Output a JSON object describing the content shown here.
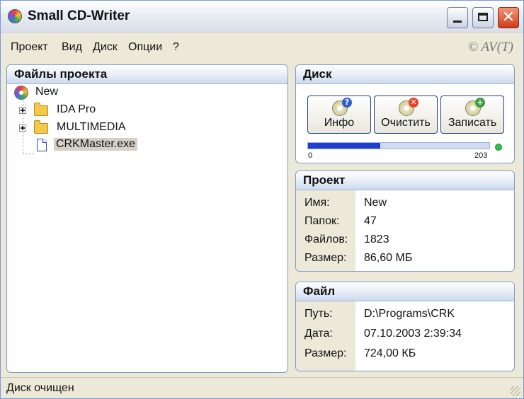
{
  "window": {
    "title": "Small CD-Writer",
    "close_glyph": "✕"
  },
  "menu": {
    "items": [
      "Проект",
      "Вид",
      "Диск",
      "Опции",
      "?"
    ],
    "copyright": "© AV(T)"
  },
  "files_panel": {
    "title": "Файлы проекта",
    "tree": [
      {
        "label": "New",
        "icon": "cd-icon"
      },
      {
        "label": "IDA Pro",
        "icon": "folder-icon",
        "expandable": true
      },
      {
        "label": "MULTIMEDIA",
        "icon": "folder-icon",
        "expandable": true
      },
      {
        "label": "CRKMaster.exe",
        "icon": "file-icon",
        "selected": true
      }
    ]
  },
  "disk_panel": {
    "title": "Диск",
    "buttons": [
      {
        "label": "Инфо",
        "icon": "disc-info-icon",
        "badge": "?"
      },
      {
        "label": "Очистить",
        "icon": "disc-erase-icon",
        "badge": "✕"
      },
      {
        "label": "Записать",
        "icon": "disc-burn-icon",
        "badge": "+"
      }
    ],
    "progress": {
      "value": 0.4,
      "min_label": "0",
      "max_label": "203"
    },
    "status_color": "#31c046"
  },
  "project_panel": {
    "title": "Проект",
    "rows": [
      {
        "key": "Имя:",
        "value": "New"
      },
      {
        "key": "Папок:",
        "value": "47"
      },
      {
        "key": "Файлов:",
        "value": "1823"
      },
      {
        "key": "Размер:",
        "value": "86,60 МБ"
      }
    ]
  },
  "file_panel": {
    "title": "Файл",
    "rows": [
      {
        "key": "Путь:",
        "value": "D:\\Programs\\CRK"
      },
      {
        "key": "Дата:",
        "value": "07.10.2003 2:39:34"
      },
      {
        "key": "Размер:",
        "value": "724,00 КБ"
      }
    ]
  },
  "statusbar": {
    "text": "Диск очищен"
  },
  "colors": {
    "accent": "#1f3ecf",
    "group_border": "#7d9ccc"
  }
}
